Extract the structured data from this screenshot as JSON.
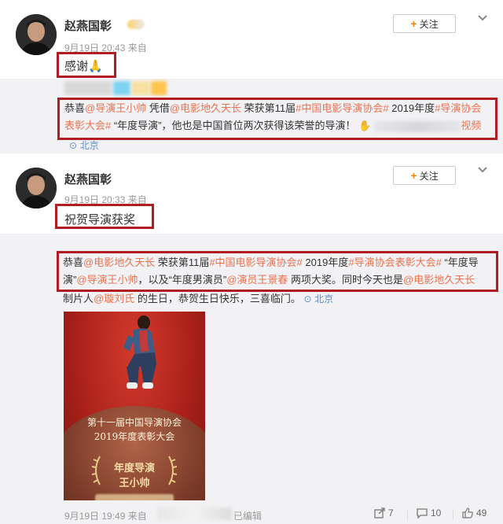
{
  "posts": [
    {
      "username": "赵燕国彰",
      "meta": "9月19日 20:43 来自",
      "follow_label": "关注",
      "text": "感谢🙏",
      "repost": {
        "segments": [
          {
            "t": "恭喜",
            "c": "plain"
          },
          {
            "t": "@导演王小帅",
            "c": "at"
          },
          {
            "t": " 凭借",
            "c": "plain"
          },
          {
            "t": "@电影地久天长",
            "c": "at"
          },
          {
            "t": " 荣获第11届",
            "c": "plain"
          },
          {
            "t": "#中国电影导演协会#",
            "c": "tag"
          },
          {
            "t": " 2019年度",
            "c": "plain"
          },
          {
            "t": "#导演协会表彰大会#",
            "c": "tag"
          },
          {
            "t": " “年度导演”，他也是中国首位两次获得该荣誉的导演！",
            "c": "plain"
          }
        ],
        "video_label": "视频",
        "location": "北京"
      }
    },
    {
      "username": "赵燕国彰",
      "meta": "9月19日 20:33 来自",
      "follow_label": "关注",
      "text": "祝贺导演获奖",
      "repost": {
        "segments": [
          {
            "t": "恭喜",
            "c": "plain"
          },
          {
            "t": "@电影地久天长",
            "c": "at"
          },
          {
            "t": " 荣获第11届",
            "c": "plain"
          },
          {
            "t": "#中国电影导演协会#",
            "c": "tag"
          },
          {
            "t": " 2019年度",
            "c": "plain"
          },
          {
            "t": "#导演协会表彰大会#",
            "c": "tag"
          },
          {
            "t": " “年度导演”",
            "c": "plain"
          },
          {
            "t": "@导演王小帅",
            "c": "at"
          },
          {
            "t": "，以及“年度男演员”",
            "c": "plain"
          },
          {
            "t": "@演员王景春",
            "c": "at"
          },
          {
            "t": " 两项大奖。同时今天也是",
            "c": "plain"
          },
          {
            "t": "@电影地久天长",
            "c": "at"
          }
        ],
        "line3_segments": [
          {
            "t": "制片人",
            "c": "plain"
          },
          {
            "t": "@璇刘氏",
            "c": "at"
          },
          {
            "t": " 的生日，恭贺生日快乐，三喜临门。",
            "c": "plain"
          }
        ],
        "location": "北京",
        "poster": {
          "line1": "第十一届中国导演协会",
          "line2": "2019年度表彰大会",
          "line3": "年度导演",
          "line4": "王小帅"
        },
        "footer": {
          "time": "9月19日 19:49 来自",
          "edited": "已编辑",
          "reposts": "7",
          "comments": "10",
          "likes": "49"
        }
      }
    }
  ],
  "colors": {
    "accent": "#eb7350",
    "highlight_box": "#b01e23",
    "follow_plus": "#ff8200",
    "repost_bg": "#f2f2f5"
  }
}
